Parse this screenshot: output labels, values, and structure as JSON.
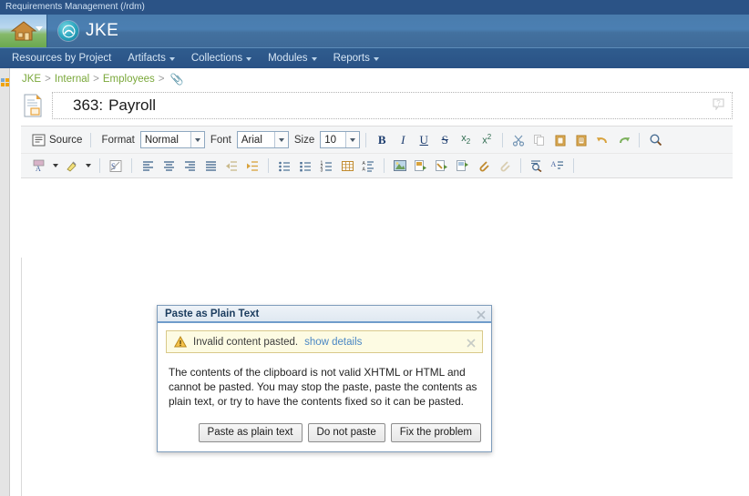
{
  "window": {
    "title": "Requirements Management (/rdm)"
  },
  "banner": {
    "home_icon": "home-icon",
    "home_caret": "chevron-down-icon",
    "logo_icon": "jke-logo-icon",
    "brand": "JKE"
  },
  "nav": {
    "items": [
      {
        "label": "Resources by Project",
        "has_menu": false
      },
      {
        "label": "Artifacts",
        "has_menu": true
      },
      {
        "label": "Collections",
        "has_menu": true
      },
      {
        "label": "Modules",
        "has_menu": true
      },
      {
        "label": "Reports",
        "has_menu": true
      }
    ]
  },
  "breadcrumb": {
    "crumbs": [
      "JKE",
      "Internal",
      "Employees"
    ],
    "separator": ">",
    "attachment_icon": "paperclip-icon"
  },
  "artifact": {
    "doc_icon": "document-icon",
    "id": "363:",
    "title": "Payroll",
    "help_icon": "help-question-icon"
  },
  "toolbar": {
    "source_label": "Source",
    "source_icon": "source-code-icon",
    "format_label": "Format",
    "format_value": "Normal",
    "font_label": "Font",
    "font_value": "Arial",
    "size_label": "Size",
    "size_value": "10",
    "row1_buttons": [
      {
        "name": "bold-icon",
        "glyph": "B"
      },
      {
        "name": "italic-icon",
        "glyph": "I"
      },
      {
        "name": "underline-icon",
        "glyph": "U"
      },
      {
        "name": "strikethrough-icon",
        "glyph": "S"
      },
      {
        "name": "subscript-icon",
        "glyph": "x₂"
      },
      {
        "name": "superscript-icon",
        "glyph": "x²"
      },
      {
        "name": "cut-icon",
        "glyph": "✂"
      },
      {
        "name": "copy-icon",
        "glyph": "❐"
      },
      {
        "name": "paste-icon",
        "glyph": "ὌB"
      },
      {
        "name": "paste-as-text-icon",
        "glyph": "ὌB"
      },
      {
        "name": "undo-icon",
        "glyph": "↶"
      },
      {
        "name": "redo-icon",
        "glyph": "↷"
      },
      {
        "name": "find-icon",
        "glyph": "ὐD"
      }
    ],
    "row2_buttons": [
      {
        "name": "text-color-icon"
      },
      {
        "name": "background-color-icon"
      },
      {
        "name": "remove-format-icon"
      },
      {
        "name": "align-left-icon"
      },
      {
        "name": "align-center-icon"
      },
      {
        "name": "align-right-icon"
      },
      {
        "name": "align-justify-icon"
      },
      {
        "name": "outdent-icon"
      },
      {
        "name": "indent-icon"
      },
      {
        "name": "bulleted-list-icon"
      },
      {
        "name": "bulleted-list-alt-icon"
      },
      {
        "name": "numbered-list-icon"
      },
      {
        "name": "table-icon"
      },
      {
        "name": "definition-list-icon"
      },
      {
        "name": "insert-image-icon"
      },
      {
        "name": "insert-artifact-icon"
      },
      {
        "name": "insert-link-icon"
      },
      {
        "name": "insert-embedded-icon"
      },
      {
        "name": "attach-file-icon"
      },
      {
        "name": "unlink-icon"
      },
      {
        "name": "find-replace-icon"
      },
      {
        "name": "spell-check-icon"
      }
    ]
  },
  "dialog": {
    "title": "Paste as Plain Text",
    "close_icon": "close-icon",
    "notice": {
      "warning_icon": "warning-triangle-icon",
      "message": "Invalid content pasted.",
      "link": "show details",
      "dismiss_icon": "close-icon"
    },
    "body": "The contents of the clipboard is not valid XHTML or HTML and cannot be pasted. You may stop the paste, paste the contents as plain text, or try to have the contents fixed so it can be pasted.",
    "buttons": [
      {
        "label": "Paste as plain text",
        "name": "paste-as-plain-text-button"
      },
      {
        "label": "Do not paste",
        "name": "do-not-paste-button"
      },
      {
        "label": "Fix the problem",
        "name": "fix-the-problem-button"
      }
    ]
  },
  "colors": {
    "top_strip": "#2b5386",
    "nav_bar": "#2a5285",
    "breadcrumb_link": "#7aa83a",
    "dialog_border": "#7e9cbb",
    "notice_bg": "#fdfbe3",
    "link": "#4a87c4"
  }
}
